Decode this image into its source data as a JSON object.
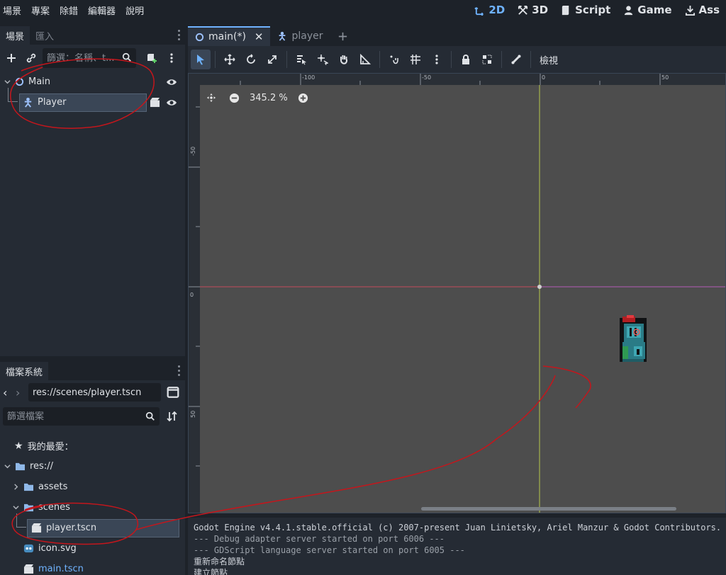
{
  "menu": [
    "場景",
    "專案",
    "除錯",
    "編輯器",
    "說明"
  ],
  "modes": [
    {
      "label": "2D",
      "icon": "2d-icon",
      "active": true
    },
    {
      "label": "3D",
      "icon": "3d-icon",
      "active": false
    },
    {
      "label": "Script",
      "icon": "script-icon",
      "active": false
    },
    {
      "label": "Game",
      "icon": "game-icon",
      "active": false
    },
    {
      "label": "Ass",
      "icon": "assetlib-icon",
      "active": false
    }
  ],
  "scene_dock": {
    "tabs": [
      "場景",
      "匯入"
    ],
    "filter_placeholder": "篩選：名稱、t...",
    "nodes": [
      {
        "label": "Main",
        "icon": "node-circle-icon"
      },
      {
        "label": "Player",
        "icon": "characterbody-icon"
      }
    ]
  },
  "editor": {
    "tabs": [
      {
        "label": "main(*)",
        "icon": "node-circle-icon",
        "active": true
      },
      {
        "label": "player",
        "icon": "characterbody-icon",
        "active": false
      }
    ],
    "view_menu": "檢視",
    "zoom": "345.2 %",
    "ruler_top": [
      "-100",
      "-50",
      "0",
      "50"
    ],
    "ruler_left": [
      "-50",
      "0",
      "50"
    ]
  },
  "filesystem": {
    "tab": "檔案系統",
    "path": "res://scenes/player.tscn",
    "filter_placeholder": "篩選檔案",
    "items": [
      {
        "label": "我的最愛：",
        "icon": "star-icon"
      },
      {
        "label": "res://",
        "icon": "folder-icon"
      },
      {
        "label": "assets",
        "icon": "folder-icon"
      },
      {
        "label": "scenes",
        "icon": "folder-icon"
      },
      {
        "label": "player.tscn",
        "icon": "scene-file-icon"
      },
      {
        "label": "icon.svg",
        "icon": "godot-icon"
      },
      {
        "label": "main.tscn",
        "icon": "scene-file-icon"
      }
    ]
  },
  "output": [
    "Godot Engine v4.4.1.stable.official (c) 2007-present Juan Linietsky, Ariel Manzur & Godot Contributors.",
    "--- Debug adapter server started on port 6006 ---",
    "--- GDScript language server started on port 6005 ---",
    "重新命名節點",
    "建立節點"
  ],
  "colors": {
    "accent": "#6fb3ff",
    "annotation": "#c4161c",
    "viewport_bg": "#4d4d4d",
    "x_axis": "#c24a5a",
    "y_axis": "#b7c94a"
  }
}
